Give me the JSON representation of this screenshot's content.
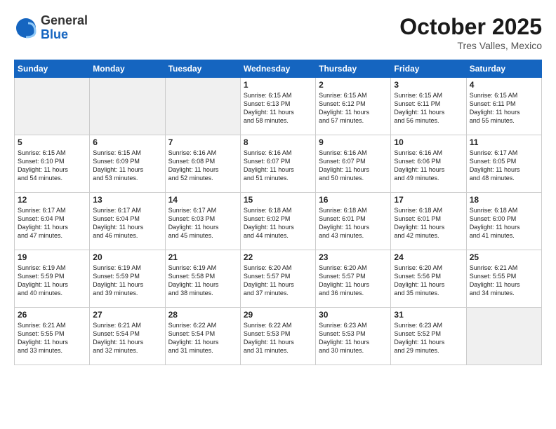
{
  "header": {
    "logo_general": "General",
    "logo_blue": "Blue",
    "month": "October 2025",
    "location": "Tres Valles, Mexico"
  },
  "days_of_week": [
    "Sunday",
    "Monday",
    "Tuesday",
    "Wednesday",
    "Thursday",
    "Friday",
    "Saturday"
  ],
  "weeks": [
    [
      {
        "day": "",
        "info": "",
        "empty": true
      },
      {
        "day": "",
        "info": "",
        "empty": true
      },
      {
        "day": "",
        "info": "",
        "empty": true
      },
      {
        "day": "1",
        "info": "Sunrise: 6:15 AM\nSunset: 6:13 PM\nDaylight: 11 hours\nand 58 minutes."
      },
      {
        "day": "2",
        "info": "Sunrise: 6:15 AM\nSunset: 6:12 PM\nDaylight: 11 hours\nand 57 minutes."
      },
      {
        "day": "3",
        "info": "Sunrise: 6:15 AM\nSunset: 6:11 PM\nDaylight: 11 hours\nand 56 minutes."
      },
      {
        "day": "4",
        "info": "Sunrise: 6:15 AM\nSunset: 6:11 PM\nDaylight: 11 hours\nand 55 minutes."
      }
    ],
    [
      {
        "day": "5",
        "info": "Sunrise: 6:15 AM\nSunset: 6:10 PM\nDaylight: 11 hours\nand 54 minutes."
      },
      {
        "day": "6",
        "info": "Sunrise: 6:15 AM\nSunset: 6:09 PM\nDaylight: 11 hours\nand 53 minutes."
      },
      {
        "day": "7",
        "info": "Sunrise: 6:16 AM\nSunset: 6:08 PM\nDaylight: 11 hours\nand 52 minutes."
      },
      {
        "day": "8",
        "info": "Sunrise: 6:16 AM\nSunset: 6:07 PM\nDaylight: 11 hours\nand 51 minutes."
      },
      {
        "day": "9",
        "info": "Sunrise: 6:16 AM\nSunset: 6:07 PM\nDaylight: 11 hours\nand 50 minutes."
      },
      {
        "day": "10",
        "info": "Sunrise: 6:16 AM\nSunset: 6:06 PM\nDaylight: 11 hours\nand 49 minutes."
      },
      {
        "day": "11",
        "info": "Sunrise: 6:17 AM\nSunset: 6:05 PM\nDaylight: 11 hours\nand 48 minutes."
      }
    ],
    [
      {
        "day": "12",
        "info": "Sunrise: 6:17 AM\nSunset: 6:04 PM\nDaylight: 11 hours\nand 47 minutes."
      },
      {
        "day": "13",
        "info": "Sunrise: 6:17 AM\nSunset: 6:04 PM\nDaylight: 11 hours\nand 46 minutes."
      },
      {
        "day": "14",
        "info": "Sunrise: 6:17 AM\nSunset: 6:03 PM\nDaylight: 11 hours\nand 45 minutes."
      },
      {
        "day": "15",
        "info": "Sunrise: 6:18 AM\nSunset: 6:02 PM\nDaylight: 11 hours\nand 44 minutes."
      },
      {
        "day": "16",
        "info": "Sunrise: 6:18 AM\nSunset: 6:01 PM\nDaylight: 11 hours\nand 43 minutes."
      },
      {
        "day": "17",
        "info": "Sunrise: 6:18 AM\nSunset: 6:01 PM\nDaylight: 11 hours\nand 42 minutes."
      },
      {
        "day": "18",
        "info": "Sunrise: 6:18 AM\nSunset: 6:00 PM\nDaylight: 11 hours\nand 41 minutes."
      }
    ],
    [
      {
        "day": "19",
        "info": "Sunrise: 6:19 AM\nSunset: 5:59 PM\nDaylight: 11 hours\nand 40 minutes."
      },
      {
        "day": "20",
        "info": "Sunrise: 6:19 AM\nSunset: 5:59 PM\nDaylight: 11 hours\nand 39 minutes."
      },
      {
        "day": "21",
        "info": "Sunrise: 6:19 AM\nSunset: 5:58 PM\nDaylight: 11 hours\nand 38 minutes."
      },
      {
        "day": "22",
        "info": "Sunrise: 6:20 AM\nSunset: 5:57 PM\nDaylight: 11 hours\nand 37 minutes."
      },
      {
        "day": "23",
        "info": "Sunrise: 6:20 AM\nSunset: 5:57 PM\nDaylight: 11 hours\nand 36 minutes."
      },
      {
        "day": "24",
        "info": "Sunrise: 6:20 AM\nSunset: 5:56 PM\nDaylight: 11 hours\nand 35 minutes."
      },
      {
        "day": "25",
        "info": "Sunrise: 6:21 AM\nSunset: 5:55 PM\nDaylight: 11 hours\nand 34 minutes."
      }
    ],
    [
      {
        "day": "26",
        "info": "Sunrise: 6:21 AM\nSunset: 5:55 PM\nDaylight: 11 hours\nand 33 minutes."
      },
      {
        "day": "27",
        "info": "Sunrise: 6:21 AM\nSunset: 5:54 PM\nDaylight: 11 hours\nand 32 minutes."
      },
      {
        "day": "28",
        "info": "Sunrise: 6:22 AM\nSunset: 5:54 PM\nDaylight: 11 hours\nand 31 minutes."
      },
      {
        "day": "29",
        "info": "Sunrise: 6:22 AM\nSunset: 5:53 PM\nDaylight: 11 hours\nand 31 minutes."
      },
      {
        "day": "30",
        "info": "Sunrise: 6:23 AM\nSunset: 5:53 PM\nDaylight: 11 hours\nand 30 minutes."
      },
      {
        "day": "31",
        "info": "Sunrise: 6:23 AM\nSunset: 5:52 PM\nDaylight: 11 hours\nand 29 minutes."
      },
      {
        "day": "",
        "info": "",
        "empty": true
      }
    ]
  ]
}
